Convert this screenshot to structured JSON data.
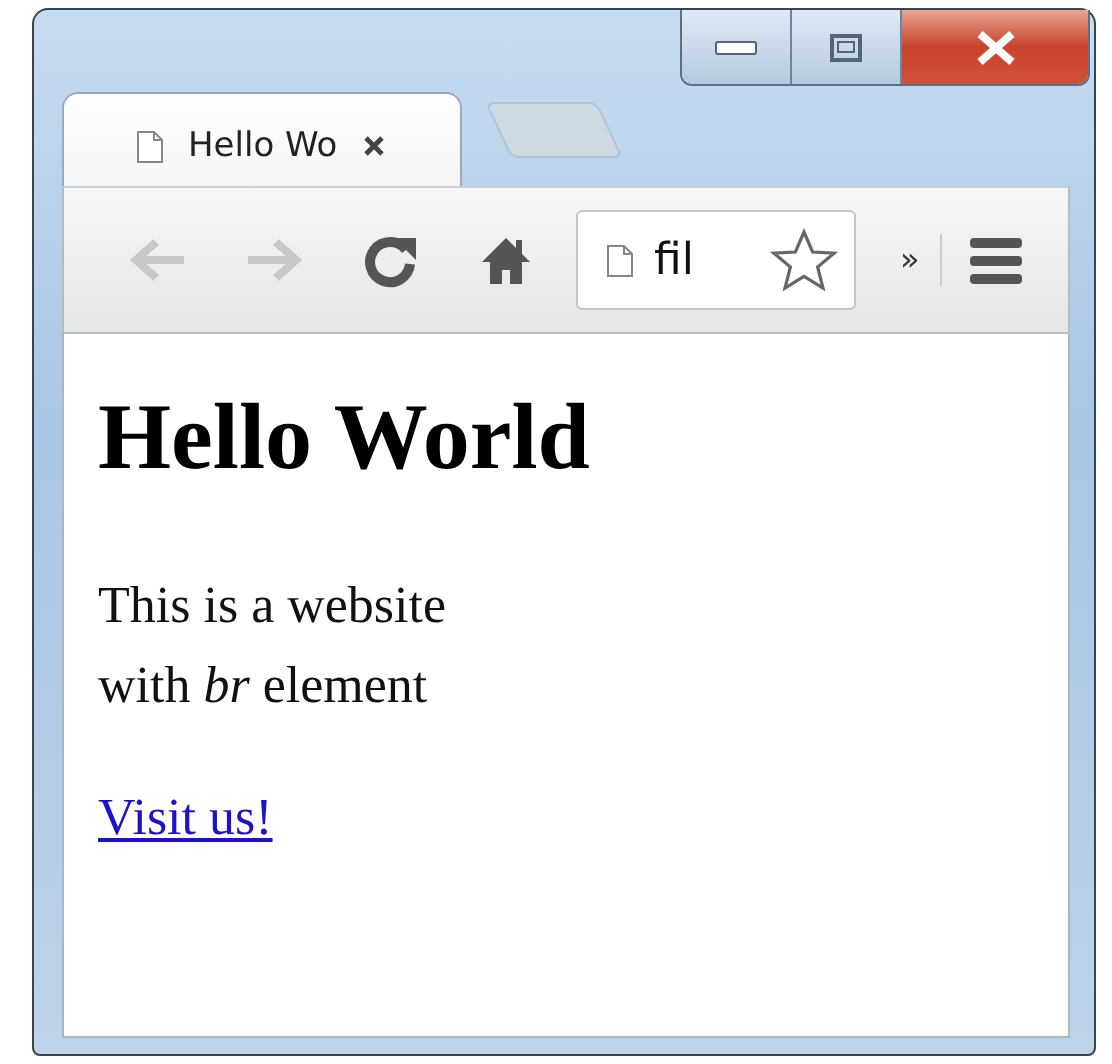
{
  "tab": {
    "title": "Hello Wo",
    "selected": true
  },
  "toolbar": {
    "back_disabled": true,
    "forward_disabled": true,
    "address": "fil",
    "extensions": "»"
  },
  "page": {
    "heading": "Hello World",
    "paragraph": "This is a website\nwith *br* element",
    "link": "Visit us!"
  }
}
